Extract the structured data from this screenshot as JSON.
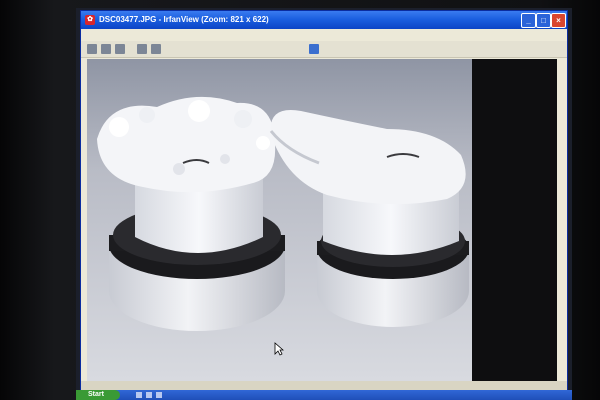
{
  "window": {
    "title": "DSC03477.JPG - IrfanView (Zoom: 821 x 622)",
    "menu_items": [],
    "toolbar_icons": [
      "open-icon",
      "save-icon",
      "print-icon",
      "zoom-in-icon",
      "zoom-out-icon",
      "settings-icon"
    ]
  },
  "statusbar": {
    "text": ""
  },
  "taskbar": {
    "start_label": "Start"
  }
}
